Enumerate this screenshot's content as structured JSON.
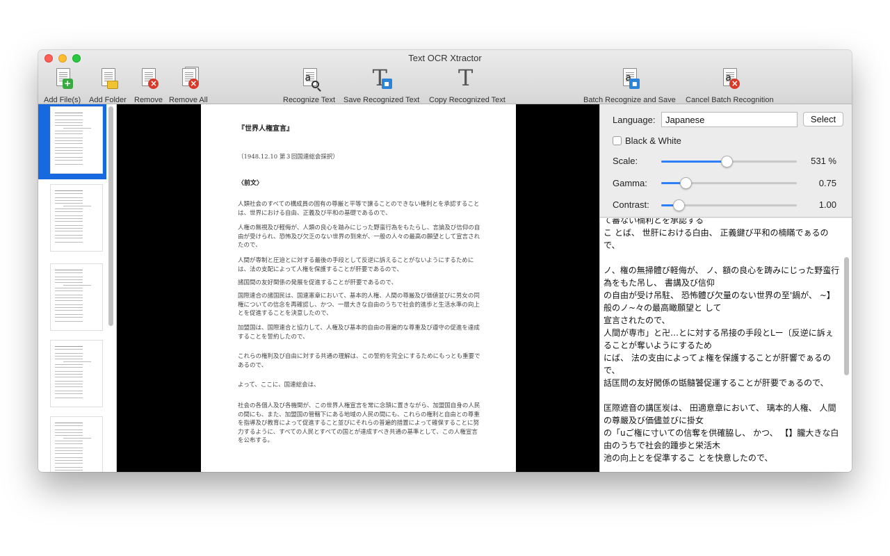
{
  "window": {
    "title": "Text OCR Xtractor"
  },
  "toolbar": {
    "add_files": "Add File(s)",
    "add_folder": "Add Folder",
    "remove": "Remove",
    "remove_all": "Remove All",
    "recognize": "Recognize Text",
    "save_recognized": "Save Recognized Text",
    "copy_recognized": "Copy Recognized Text",
    "batch_save": "Batch Recognize and Save",
    "cancel_batch": "Cancel Batch Recognition"
  },
  "settings": {
    "language_label": "Language:",
    "language_value": "Japanese",
    "select_button": "Select",
    "bw_label": "Black & White",
    "bw_checked": false,
    "scale_label": "Scale:",
    "scale_value": "531 %",
    "scale_fraction": 0.48,
    "gamma_label": "Gamma:",
    "gamma_value": "0.75",
    "gamma_fraction": 0.18,
    "contrast_label": "Contrast:",
    "contrast_value": "1.00",
    "contrast_fraction": 0.13,
    "accent": "#2d7ff9"
  },
  "document": {
    "title": "『世界人権宣言』",
    "date": "（1948.12.10 第３回国連総会採択）",
    "preamble": "〈前文〉",
    "paragraphs": [
      "人類社会のすべての構成員の固有の尊厳と平等で譲ることのできない権利とを承認することは、世界における自由、正義及び平和の基礎であるので、",
      "人権の無視及び軽侮が、人類の良心を踏みにじった野蛮行為をもたらし、言論及び信仰の自由が受けられ、恐怖及び欠乏のない世界の到来が、一般の人々の最高の願望として宣言されたので、",
      "人間が専制と圧迫とに対する最後の手段として反逆に訴えることがないようにするためには、法の支配によって人権を保護することが肝要であるので、",
      "諸国間の友好関係の発展を促進することが肝要であるので、",
      "国際連合の諸国民は、国連憲章において、基本的人権、人間の尊厳及び価値並びに男女の同権についての信念を再確認し、かつ、一層大きな自由のうちで社会的進歩と生活水準の向上とを促進することを決意したので、",
      "加盟国は、国際連合と協力して、人権及び基本的自由の普遍的な尊重及び遵守の促進を達成することを誓約したので、",
      "これらの権利及び自由に対する共通の理解は、この誓約を完全にするためにもっとも重要であるので、",
      "よって、ここに、国連総会は、",
      "社会の各個人及び各機関が、この世界人権宣言を常に念頭に置きながら、加盟国自身の人民の間にも、また、加盟国の管轄下にある地域の人民の間にも、これらの権利と自由との尊重を指導及び教育によって促進すること並びにそれらの普遍的措置によって確保することに努力するように、すべての人民とすべての国とが達成すべき共通の基準として、この人権宣言を公布する。"
    ]
  },
  "recognized_text": "て審ない楠利とを承認する\nこ とば、 世肝における白由、 正義鍵び平和の楠瞞でぁるので、\n\nノ、権の無掃體び軽侮が、 ノ、額の良心を踌みにじった野蛮行為をもた吊し、 書講及び信仰\nの自由が受け吊駐、 恐怖體び欠量のない世界の至'鍋が、 ~】般のノ~々の最高瞰願望と して\n宣言されたので、\n人間が専市」と卍…とに対する吊接の手段とLー〔反逆に訴ぇることが奪いようにするため\nにば、 法の支由によってょ権を保護することが肝響でぁるので、\n話匡問の友好闖係の甛髓饕促運することが肝要でぁるので、\n\n匡際遮音の講匡炭は、 田適意章において、 璃本的人権、 人間の尊嚴及び価儘並びに掛女\nの「uご権に寸いての信奪を供確脇し、 かつ、 【】朧大きな白由のうちで社会的踵歩と栄活木\n池の向上とを促準するこ とを快意したので、\n\n加醒匡は、 田瞭遅合と協ノjして、 ノ、権廏び璃本的自由の井適的な蓐闘纔び濾陸の促種を"
}
